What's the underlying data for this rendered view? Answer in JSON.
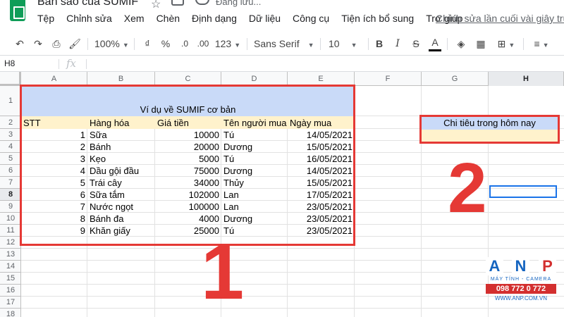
{
  "doc": {
    "title": "Bản sao của SUMIF",
    "saving": "Đang lưu...",
    "last_edit": "Chỉnh sửa lần cuối vài giây trước"
  },
  "menu": [
    "Tệp",
    "Chỉnh sửa",
    "Xem",
    "Chèn",
    "Định dạng",
    "Dữ liệu",
    "Công cụ",
    "Tiện ích bổ sung",
    "Trợ giúp"
  ],
  "toolbar": {
    "zoom": "100%",
    "currency": "₫",
    "percent": "%",
    "dec_decrease": ".0",
    "dec_increase": ".00",
    "format_more": "123",
    "font": "Sans Serif",
    "font_size": "10",
    "bold": "B",
    "italic": "I",
    "strike": "S",
    "text_color": "A"
  },
  "formula_bar": {
    "name_box": "H8",
    "fx": "fx"
  },
  "columns": [
    "A",
    "B",
    "C",
    "D",
    "E",
    "F",
    "G",
    "H"
  ],
  "selected_column": "H",
  "rows": [
    "1",
    "2",
    "3",
    "4",
    "5",
    "6",
    "7",
    "8",
    "9",
    "10",
    "11",
    "12",
    "13",
    "14",
    "15",
    "16",
    "17",
    "18"
  ],
  "selected_row": "8",
  "table": {
    "title": "Ví dụ về SUMIF cơ bản",
    "headers": [
      "STT",
      "Hàng hóa",
      "Giá tiền",
      "Tên người mua",
      "Ngày mua"
    ],
    "rows": [
      [
        "1",
        "Sữa",
        "10000",
        "Tú",
        "14/05/2021"
      ],
      [
        "2",
        "Bánh",
        "20000",
        "Dương",
        "15/05/2021"
      ],
      [
        "3",
        "Kẹo",
        "5000",
        "Tú",
        "16/05/2021"
      ],
      [
        "4",
        "Dầu gội đầu",
        "75000",
        "Dương",
        "14/05/2021"
      ],
      [
        "5",
        "Trái cây",
        "34000",
        "Thủy",
        "15/05/2021"
      ],
      [
        "6",
        "Sữa tắm",
        "102000",
        "Lan",
        "17/05/2021"
      ],
      [
        "7",
        "Nước ngọt",
        "100000",
        "Lan",
        "23/05/2021"
      ],
      [
        "8",
        "Bánh đa",
        "4000",
        "Dương",
        "23/05/2021"
      ],
      [
        "9",
        "Khăn giấy",
        "25000",
        "Tú",
        "23/05/2021"
      ]
    ]
  },
  "summary": {
    "label": "Chi tiêu trong hôm nay",
    "value": ""
  },
  "annotations": {
    "marker_1": "1",
    "marker_2": "2"
  },
  "watermark": {
    "letters": [
      "A",
      "N",
      "P"
    ],
    "tagline": "MÁY TÍNH - CAMERA",
    "phone": "098 772 0 772",
    "website": "WWW.ANP.COM.VN"
  },
  "colors": {
    "title_bg": "#c9daf8",
    "header_bg": "#fff2cc",
    "annotation_red": "#e53935",
    "selection_blue": "#1a73e8"
  }
}
